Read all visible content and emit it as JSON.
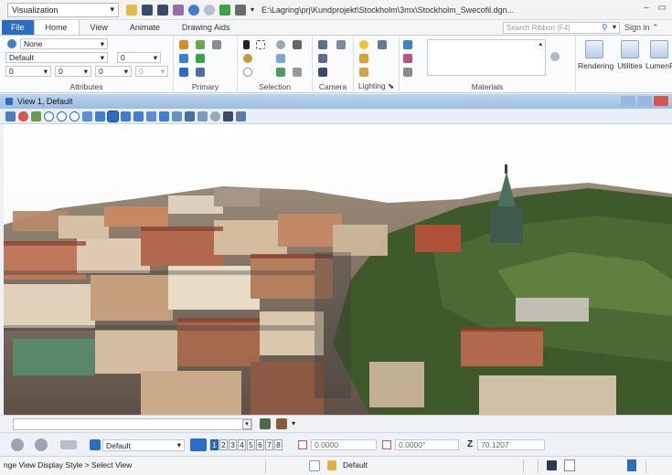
{
  "titlebar": {
    "workspace": "Visualization",
    "path": "E:\\Lagring\\prj\\Kundprojekt\\Stockholm\\3mx\\Stockholm_Swecofil.dgn...",
    "minimize": "–",
    "restore": "▭"
  },
  "tabs": [
    {
      "label": "File"
    },
    {
      "label": "Home"
    },
    {
      "label": "View"
    },
    {
      "label": "Animate"
    },
    {
      "label": "Drawing Aids"
    }
  ],
  "search": {
    "placeholder": "Search Ribbon (F4)"
  },
  "signin": {
    "label": "Sign in"
  },
  "ribbon": {
    "attributes": {
      "label": "Attributes",
      "level": "None",
      "style": "Default",
      "weight": "0",
      "color": "0",
      "line_style": "0",
      "transparency": "0",
      "priority": "0"
    },
    "primary": {
      "label": "Primary"
    },
    "selection": {
      "label": "Selection"
    },
    "camera": {
      "label": "Camera"
    },
    "lighting": {
      "label": "Lighting"
    },
    "materials": {
      "label": "Materials"
    },
    "rendering": {
      "label": "Rendering"
    },
    "utilities": {
      "label": "Utilities"
    },
    "lumenrt": {
      "label": "LumenR"
    }
  },
  "view": {
    "title": "View 1, Default"
  },
  "viewbar": {
    "display_style": "Default",
    "views": [
      "1",
      "2",
      "3",
      "4",
      "5",
      "6",
      "7",
      "8"
    ],
    "selected_view": "1",
    "x": "0.0000",
    "angle": "0.0000°",
    "z_label": "Z",
    "z": "70.1207"
  },
  "status": {
    "prompt": "nge View Display Style > Select View",
    "level": "Default"
  },
  "colors": {
    "accent": "#2b6cc4",
    "view_title": "#b3cdeb"
  }
}
